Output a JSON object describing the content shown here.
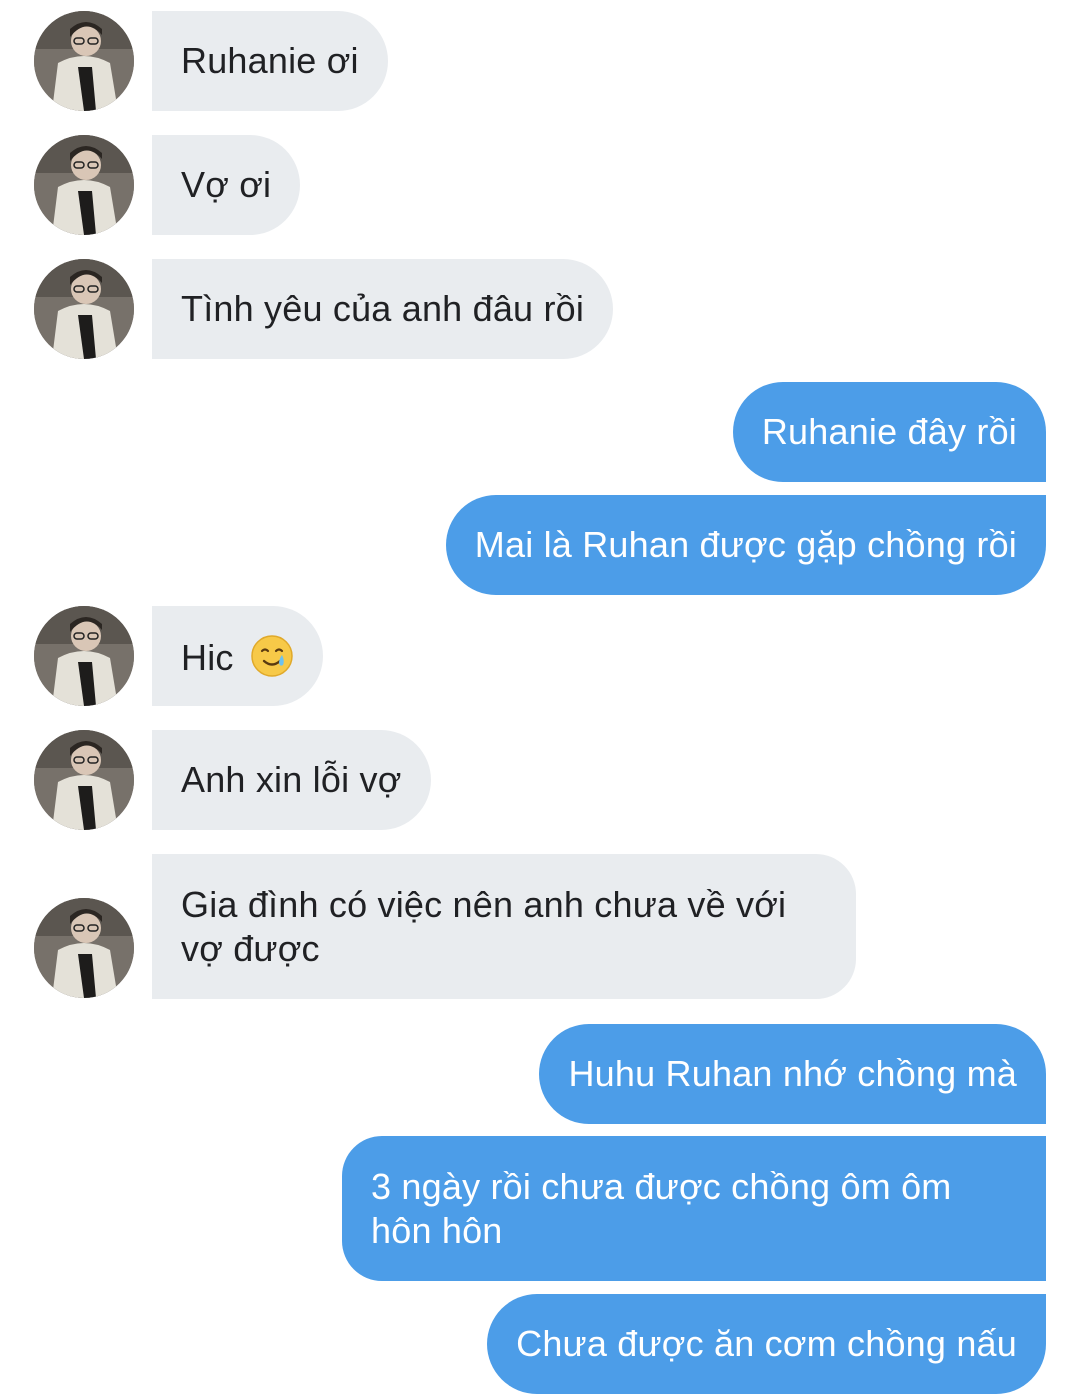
{
  "conversation": {
    "messages": [
      {
        "sender": "them",
        "text": "Ruhanie ơi"
      },
      {
        "sender": "them",
        "text": "Vợ ơi"
      },
      {
        "sender": "them",
        "text": "Tình yêu của anh đâu rồi"
      },
      {
        "sender": "me",
        "text": "Ruhanie đây rồi"
      },
      {
        "sender": "me",
        "text": "Mai là Ruhan được gặp chồng rồi"
      },
      {
        "sender": "them",
        "text": "Hic",
        "emoji": "smiling-face-with-tear-icon"
      },
      {
        "sender": "them",
        "text": "Anh xin lỗi vợ"
      },
      {
        "sender": "them",
        "text": "Gia đình có việc nên anh chưa về với vợ được"
      },
      {
        "sender": "me",
        "text": "Huhu Ruhan nhớ chồng mà"
      },
      {
        "sender": "me",
        "text": "3 ngày rồi chưa được chồng ôm ôm hôn hôn"
      },
      {
        "sender": "me",
        "text": "Chưa được ăn cơm chồng nấu"
      }
    ]
  },
  "colors": {
    "incoming_bubble": "#e9ecef",
    "outgoing_bubble": "#4c9de8",
    "incoming_text": "#202124",
    "outgoing_text": "#ffffff"
  }
}
